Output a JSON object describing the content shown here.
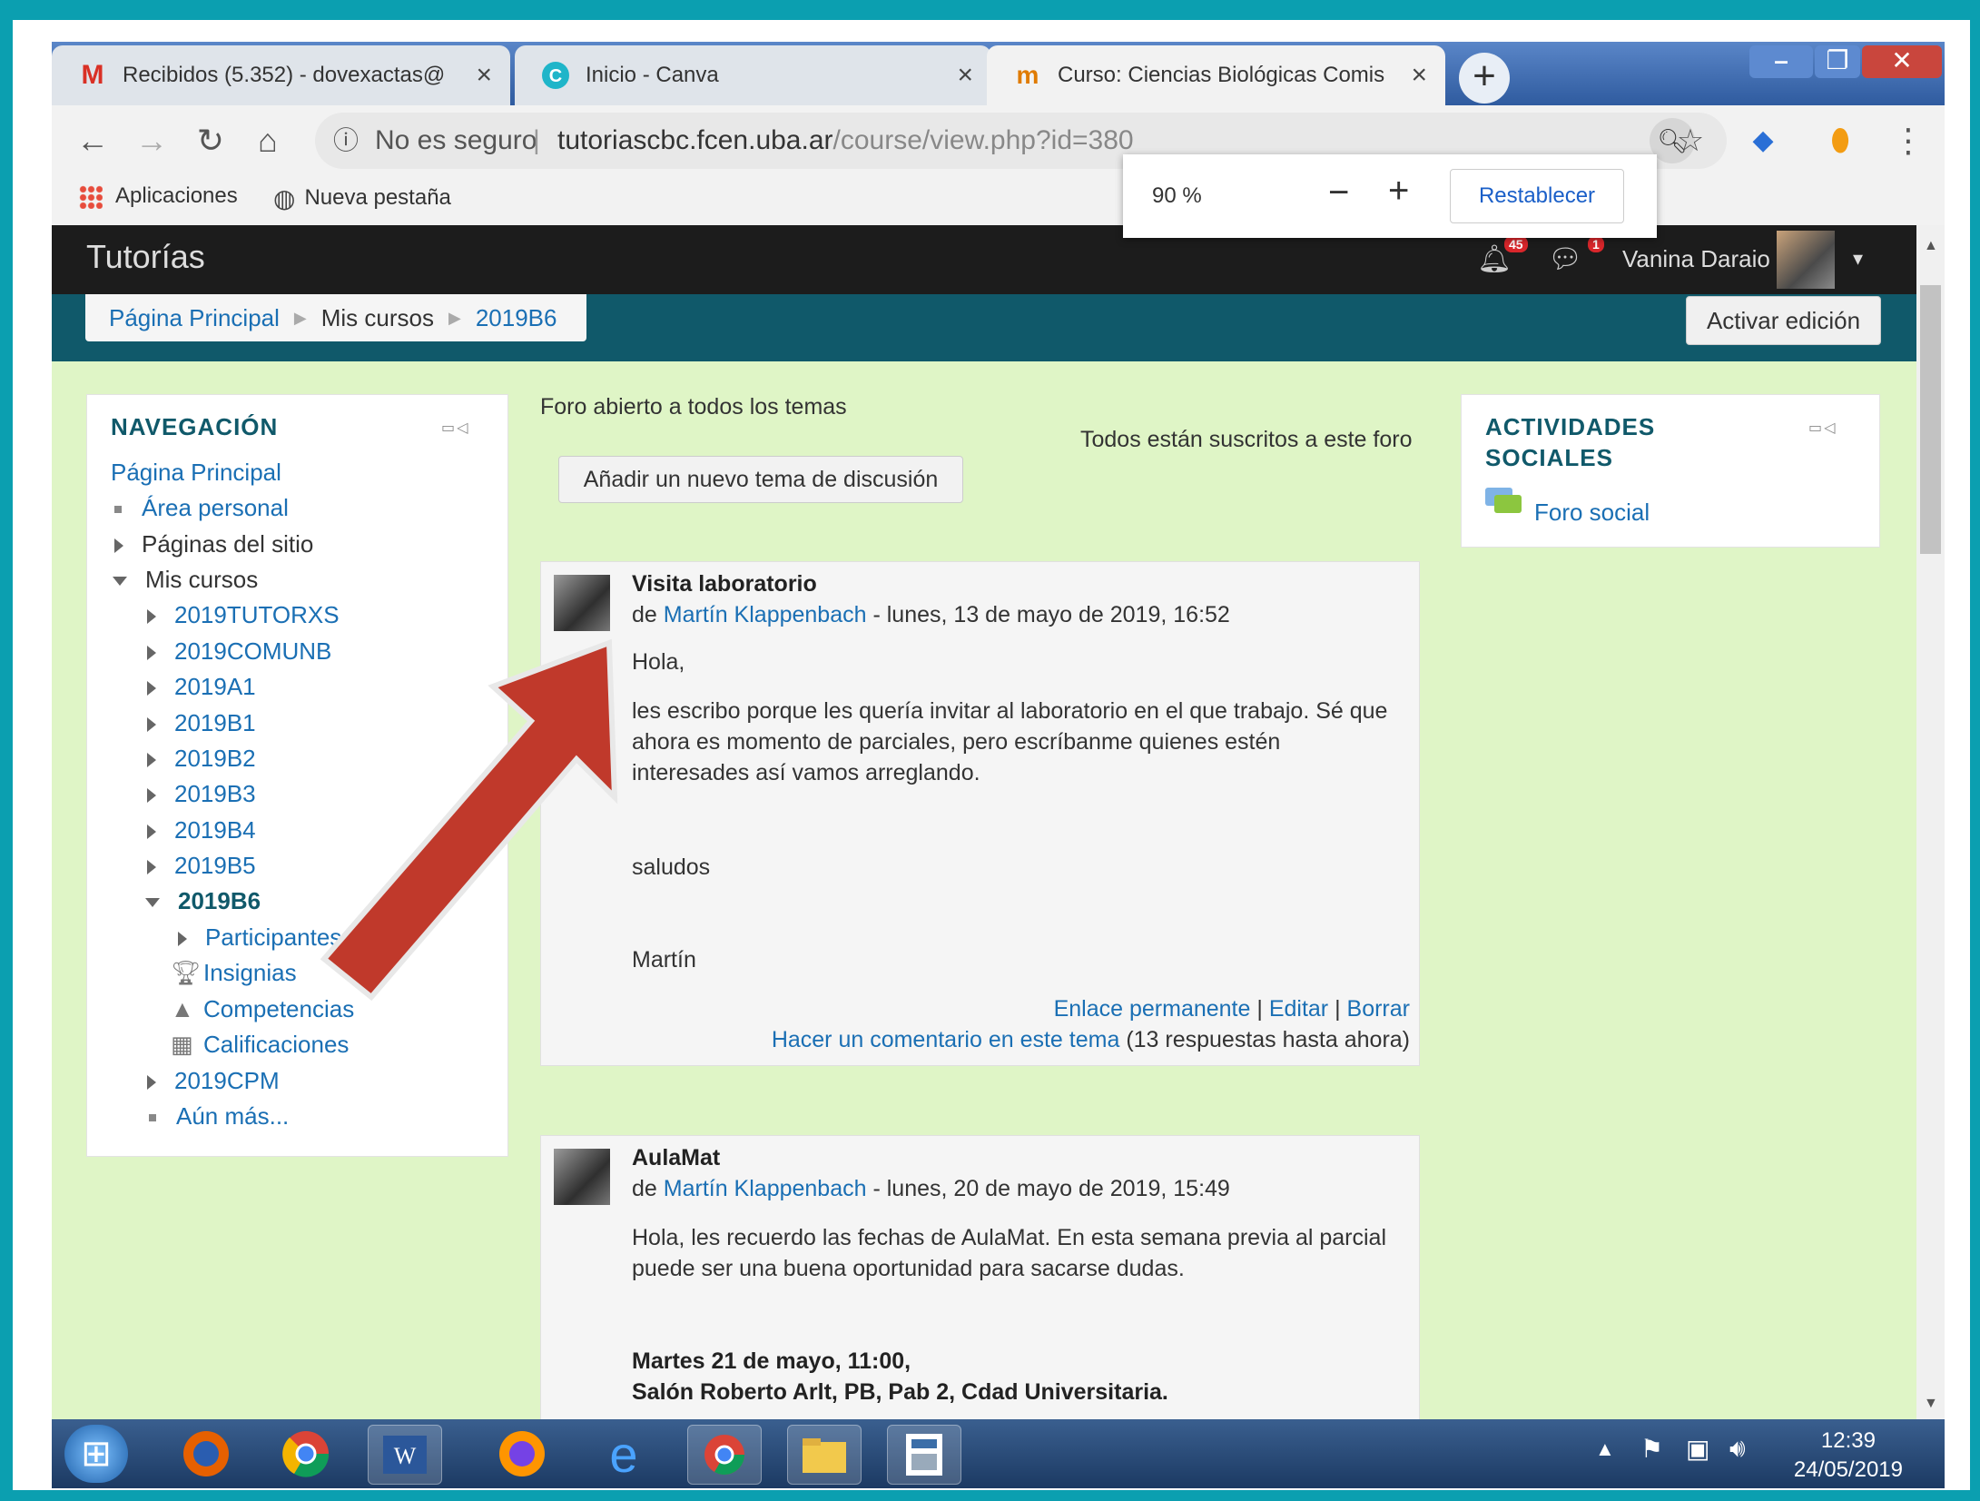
{
  "browser": {
    "tabs": [
      {
        "label": "Recibidos (5.352) - dovexactas@",
        "icon": "gmail-icon"
      },
      {
        "label": "Inicio - Canva",
        "icon": "canva-icon"
      },
      {
        "label": "Curso: Ciencias Biológicas Comis",
        "icon": "moodle-icon",
        "active": true
      }
    ],
    "address": {
      "security": "No es seguro",
      "host": "tutoriascbc.fcen.uba.ar",
      "path": "/course/view.php?id=380"
    },
    "bookmarks": {
      "apps": "Aplicaciones",
      "newtab": "Nueva pestaña"
    },
    "zoom": {
      "value": "90 %",
      "minus": "−",
      "plus": "+",
      "reset": "Restablecer"
    }
  },
  "moodle": {
    "brand": "Tutorías",
    "notifications": {
      "alerts": "45",
      "messages": "1"
    },
    "user": "Vanina Daraio",
    "breadcrumbs": [
      "Página Principal",
      "Mis cursos",
      "2019B6"
    ],
    "edit_button": "Activar edición"
  },
  "navigation": {
    "title": "NAVEGACIÓN",
    "home": "Página Principal",
    "personal": "Área personal",
    "site_pages": "Páginas del sitio",
    "my_courses": "Mis cursos",
    "courses": [
      "2019TUTORXS",
      "2019COMUNB",
      "2019A1",
      "2019B1",
      "2019B2",
      "2019B3",
      "2019B4",
      "2019B5"
    ],
    "current_course": "2019B6",
    "course_items": [
      "Participantes",
      "Insignias",
      "Competencias",
      "Calificaciones"
    ],
    "after_course": "2019CPM",
    "more": "Aún más..."
  },
  "forum": {
    "description": "Foro abierto a todos los temas",
    "subscribed": "Todos están suscritos a este foro",
    "add_button": "Añadir un nuevo tema de discusión",
    "posts": [
      {
        "title": "Visita laboratorio",
        "by": "de",
        "author": "Martín Klappenbach",
        "date": "- lunes, 13 de mayo de 2019, 16:52",
        "lines": [
          "Hola,",
          "les escribo porque les quería invitar al laboratorio en el que trabajo. Sé que",
          "ahora es momento de parciales, pero escríbanme quienes estén",
          "interesades así vamos arreglando.",
          "saludos",
          "Martín"
        ],
        "permalink": "Enlace permanente",
        "edit": "Editar",
        "delete": "Borrar",
        "pipe": "|",
        "comment": "Hacer un comentario en este tema",
        "replies": "(13 respuestas hasta ahora)"
      },
      {
        "title": "AulaMat",
        "by": "de",
        "author": "Martín Klappenbach",
        "date": "- lunes, 20 de mayo de 2019, 15:49",
        "lines": [
          "Hola, les recuerdo las fechas de AulaMat. En esta semana previa al parcial",
          "puede ser una buena oportunidad para sacarse dudas."
        ],
        "bold_lines": [
          "Martes 21 de mayo, 11:00,",
          "Salón Roberto Arlt, PB, Pab 2, Cdad Universitaria."
        ]
      }
    ]
  },
  "social": {
    "title_1": "ACTIVIDADES",
    "title_2": "SOCIALES",
    "link": "Foro social"
  },
  "taskbar": {
    "time": "12:39",
    "date": "24/05/2019"
  },
  "colors": {
    "frame_bg": "#0b9fb0",
    "moodle_green": "#dff5c6",
    "link": "#1a6fb4",
    "arrow": "#c0392b"
  }
}
